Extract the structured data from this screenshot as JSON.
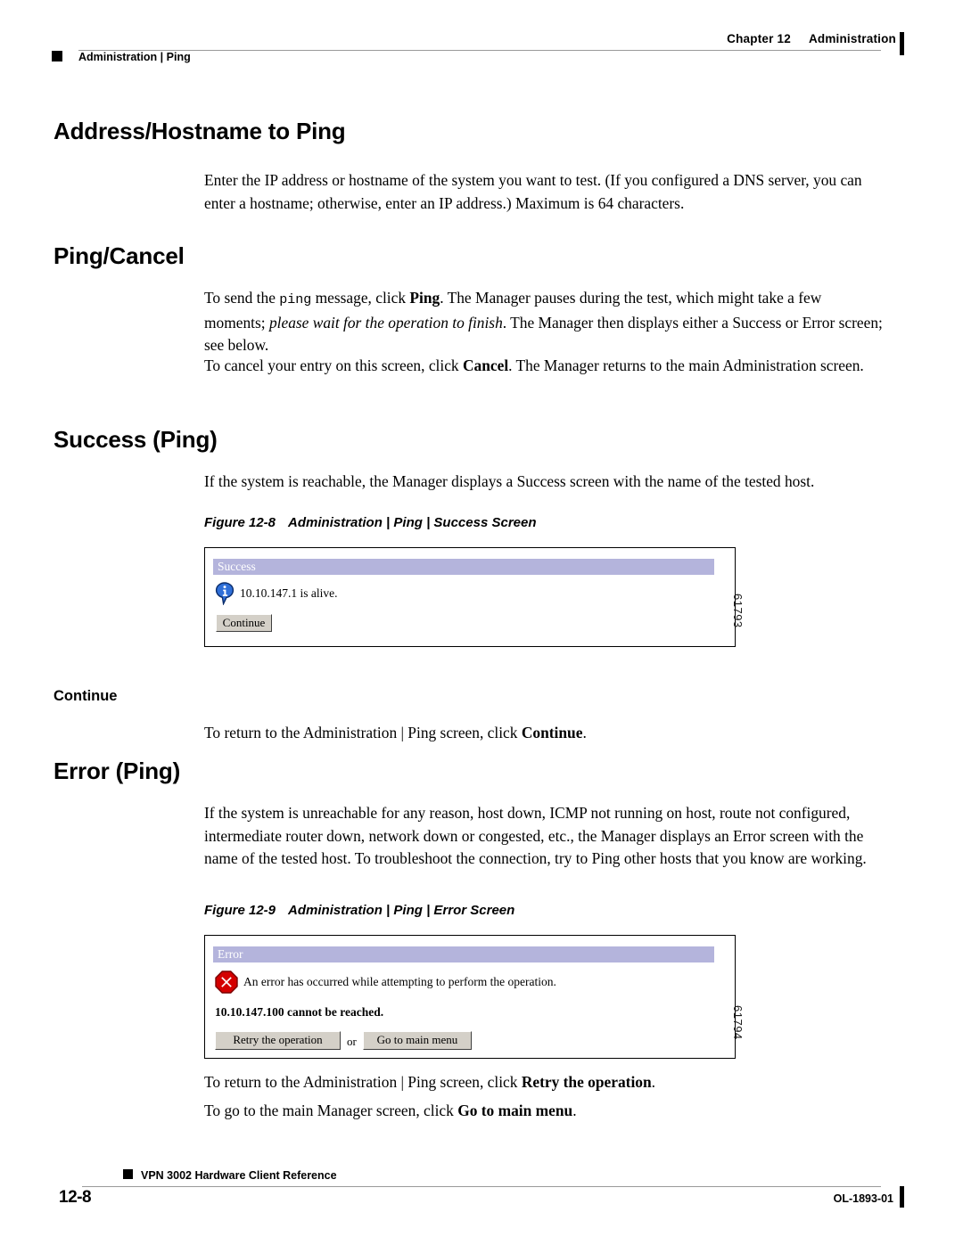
{
  "header": {
    "chapter_number": "Chapter 12",
    "chapter_title": "Administration",
    "breadcrumb": "Administration | Ping"
  },
  "sections": {
    "address_hostname": {
      "heading": "Address/Hostname to Ping",
      "paragraph": "Enter the IP address or hostname of the system you want to test. (If you configured a DNS server, you can enter a hostname; otherwise, enter an IP address.) Maximum is 64 characters."
    },
    "ping_cancel": {
      "heading": "Ping/Cancel",
      "para1_a": "To send the ",
      "para1_mono": "ping",
      "para1_b": " message, click ",
      "para1_bold1": "Ping",
      "para1_c": ". The Manager pauses during the test, which might take a few moments; ",
      "para1_italic": "please wait for the operation to finish",
      "para1_d": ". The Manager then displays either a Success or Error screen; see below.",
      "para2_a": "To cancel your entry on this screen, click ",
      "para2_bold": "Cancel",
      "para2_b": ". The Manager returns to the main Administration screen."
    },
    "success_ping": {
      "heading": "Success (Ping)",
      "paragraph": "If the system is reachable, the Manager displays a Success screen with the name of the tested host."
    },
    "continue": {
      "heading": "Continue",
      "para_a": "To return to the Administration | Ping screen, click ",
      "para_bold": "Continue",
      "para_b": "."
    },
    "error_ping": {
      "heading": "Error (Ping)",
      "paragraph": "If the system is unreachable for any reason, host down, ICMP not running on host, route not configured, intermediate router down, network down or congested, etc., the Manager displays an Error screen with the name of the tested host. To troubleshoot the connection, try to Ping other hosts that you know are working.",
      "para_retry_a": "To return to the Administration | Ping screen, click ",
      "para_retry_bold": "Retry the operation",
      "para_retry_b": ".",
      "para_menu_a": "To go to the main Manager screen, click ",
      "para_menu_bold": "Go to main menu",
      "para_menu_b": "."
    }
  },
  "figures": {
    "success": {
      "caption_label": "Figure 12-8",
      "caption_title": "Administration | Ping | Success Screen",
      "art_id": "61793",
      "dialog": {
        "titlebar": "Success",
        "icon": "info-icon",
        "message": "10.10.147.1 is alive.",
        "button_continue": "Continue"
      }
    },
    "error": {
      "caption_label": "Figure 12-9",
      "caption_title": "Administration | Ping | Error Screen",
      "art_id": "61794",
      "dialog": {
        "titlebar": "Error",
        "icon": "error-octagon-icon",
        "message": "An error has occurred while attempting to perform the operation.",
        "detail": "10.10.147.100 cannot be reached.",
        "button_retry": "Retry the operation",
        "separator": "or",
        "button_main_menu": "Go to main menu"
      }
    }
  },
  "footer": {
    "doc_title": "VPN 3002 Hardware Client Reference",
    "page_number": "12-8",
    "doc_id": "OL-1893-01"
  },
  "colors": {
    "dialog_titlebar": "#b4b4dc",
    "dialog_button_face": "#d4d0c8",
    "error_icon": "#d40000",
    "info_icon": "#1f5fd0",
    "rule": "#9a9a9a"
  }
}
